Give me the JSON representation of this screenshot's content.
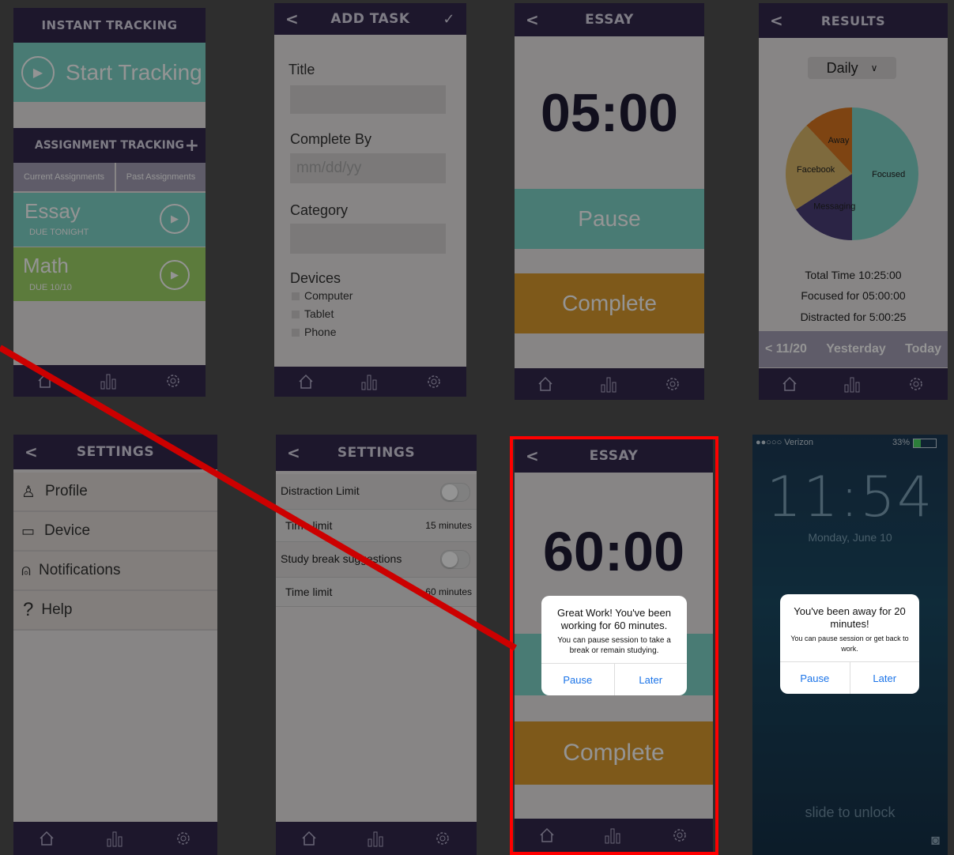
{
  "screen1": {
    "header": "INSTANT TRACKING",
    "start_label": "Start Tracking",
    "section_header": "ASSIGNMENT TRACKING",
    "add_symbol": "+",
    "tab_current": "Current Assignments",
    "tab_past": "Past Assignments",
    "assignments": [
      {
        "title": "Essay",
        "due": "DUE TONIGHT",
        "color": "#7fd4c8"
      },
      {
        "title": "Math",
        "due": "DUE 10/10",
        "color": "#9fd468"
      }
    ]
  },
  "screen2": {
    "header": "ADD TASK",
    "back": "<",
    "confirm": "✓",
    "title_label": "Title",
    "complete_by_label": "Complete By",
    "date_placeholder": "mm/dd/yy",
    "category_label": "Category",
    "devices_label": "Devices",
    "devices": [
      "Computer",
      "Tablet",
      "Phone"
    ]
  },
  "screen3": {
    "header": "ESSAY",
    "back": "<",
    "timer": "05:00",
    "pause_label": "Pause",
    "complete_label": "Complete"
  },
  "screen4": {
    "header": "RESULTS",
    "back": "<",
    "period": "Daily",
    "total": "Total Time 10:25:00",
    "focused": "Focused for 05:00:00",
    "distracted": "Distracted for 5:00:25",
    "nav_date": "< 11/20",
    "nav_yesterday": "Yesterday",
    "nav_today": "Today",
    "chart_data": {
      "type": "pie",
      "labels": [
        "Focused",
        "Messaging",
        "Facebook",
        "Away"
      ],
      "values": [
        50,
        16,
        22,
        12
      ],
      "colors": [
        "#7fd4c8",
        "#4a3f78",
        "#d9b76a",
        "#d9761f"
      ]
    }
  },
  "screen5": {
    "header": "SETTINGS",
    "back": "<",
    "items": [
      {
        "label": "Profile",
        "icon": "person-icon"
      },
      {
        "label": "Device",
        "icon": "devices-icon"
      },
      {
        "label": "Notifications",
        "icon": "bell-icon"
      },
      {
        "label": "Help",
        "icon": "question-icon"
      }
    ]
  },
  "screen6": {
    "header": "SETTINGS",
    "back": "<",
    "distraction_limit": "Distraction Limit",
    "time_limit": "Time limit",
    "time_limit_value_1": "15 minutes",
    "study_break": "Study break suggestions",
    "time_limit_value_2": "60 minutes"
  },
  "screen7": {
    "header": "ESSAY",
    "back": "<",
    "timer": "60:00",
    "complete_label": "Complete",
    "alert": {
      "title": "Great Work! You've been working for 60 minutes.",
      "message": "You can pause session to take a break or remain studying.",
      "btn_left": "Pause",
      "btn_right": "Later"
    },
    "highlight_color": "#ff0000"
  },
  "screen8": {
    "carrier": "●●○○○ Verizon",
    "battery": "33%",
    "time": "11:54",
    "date": "Monday, June 10",
    "alert": {
      "title": "You've been away for 20 minutes!",
      "message": "You can pause session or get back to work.",
      "btn_left": "Pause",
      "btn_right": "Later"
    },
    "slide_text": "slide to unlock"
  }
}
